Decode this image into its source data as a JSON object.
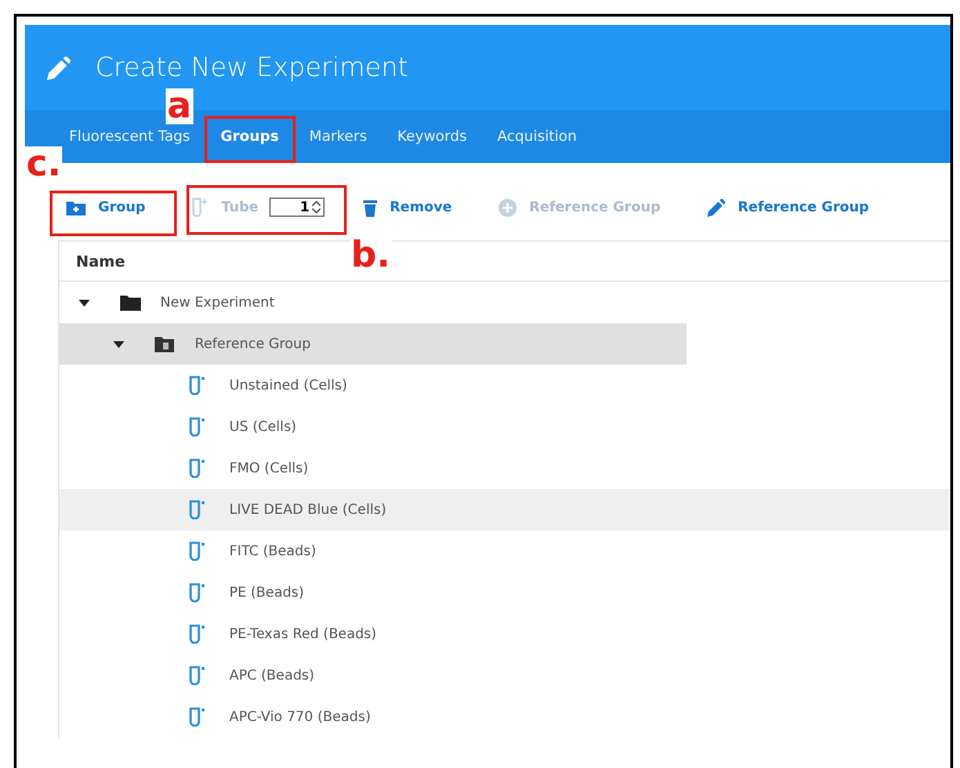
{
  "window": {
    "title": "Create New Experiment"
  },
  "tabs": [
    {
      "label": "Fluorescent Tags",
      "selected": false
    },
    {
      "label": "Groups",
      "selected": true
    },
    {
      "label": "Markers",
      "selected": false
    },
    {
      "label": "Keywords",
      "selected": false
    },
    {
      "label": "Acquisition",
      "selected": false
    }
  ],
  "toolbar": [
    {
      "kind": "add-group",
      "label": "Group",
      "disabled": false
    },
    {
      "kind": "add-tube",
      "label": "Tube",
      "disabled": true
    },
    {
      "kind": "stepper",
      "value": "1"
    },
    {
      "kind": "remove",
      "label": "Remove",
      "disabled": false
    },
    {
      "kind": "add-reference",
      "label": "Reference Group",
      "disabled": true
    },
    {
      "kind": "edit-reference",
      "label": "Reference Group",
      "disabled": false
    }
  ],
  "table": {
    "columns": [
      "Name"
    ],
    "tree": [
      {
        "kind": "folder",
        "label": "New Experiment",
        "expanded": true,
        "selected": false,
        "children": [
          {
            "kind": "reference-folder",
            "label": "Reference Group",
            "expanded": true,
            "selected": true,
            "children": [
              {
                "kind": "tube",
                "label": "Unstained (Cells)",
                "selected": false,
                "hovered": false
              },
              {
                "kind": "tube",
                "label": "US (Cells)",
                "selected": false,
                "hovered": false
              },
              {
                "kind": "tube",
                "label": "FMO (Cells)",
                "selected": false,
                "hovered": false
              },
              {
                "kind": "tube",
                "label": "LIVE DEAD Blue (Cells)",
                "selected": false,
                "hovered": true
              },
              {
                "kind": "tube",
                "label": "FITC (Beads)",
                "selected": false,
                "hovered": false
              },
              {
                "kind": "tube",
                "label": "PE (Beads)",
                "selected": false,
                "hovered": false
              },
              {
                "kind": "tube",
                "label": "PE-Texas Red (Beads)",
                "selected": false,
                "hovered": false
              },
              {
                "kind": "tube",
                "label": "APC (Beads)",
                "selected": false,
                "hovered": false
              },
              {
                "kind": "tube",
                "label": "APC-Vio 770 (Beads)",
                "selected": false,
                "hovered": false
              }
            ]
          }
        ]
      }
    ]
  },
  "annotations": [
    {
      "label": "a"
    },
    {
      "label": "b."
    },
    {
      "label": "c."
    }
  ]
}
